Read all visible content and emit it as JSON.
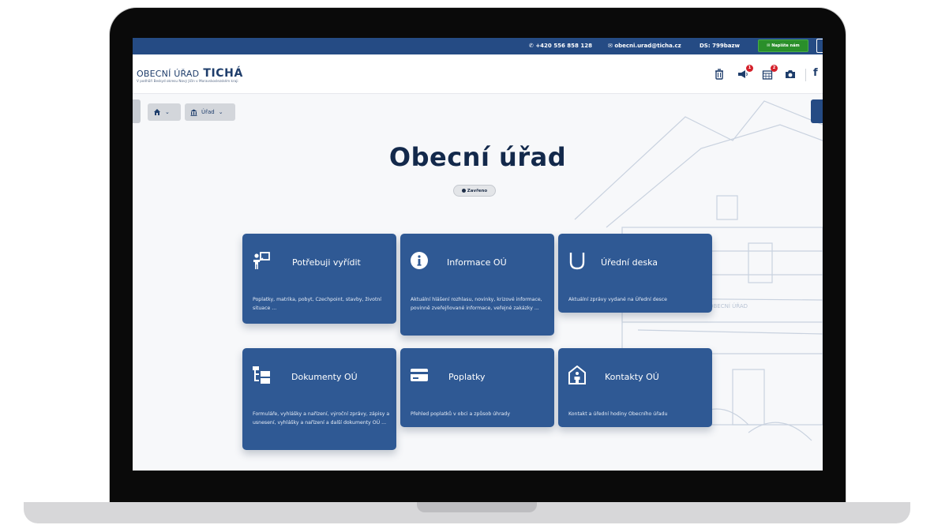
{
  "topbar": {
    "phone": "+420 556 858 128",
    "email": "obecni.urad@ticha.cz",
    "ds": "DS: 799bazw",
    "write_label": "✉ Napište nám"
  },
  "header": {
    "brand_light": "OBECNÍ ÚŘAD",
    "brand_bold": "TICHÁ",
    "brand_sub": "V podhůří Beskyd okresu Nový Jičín v Moravskoslezském kraji",
    "badges": {
      "announcements": "1",
      "calendar": "2"
    },
    "social": "f"
  },
  "breadcrumb": {
    "home_chevron": "⌄",
    "urad_label": "Úřad",
    "urad_chevron": "⌄"
  },
  "page": {
    "title": "Obecní úřad",
    "status": "Zavřeno"
  },
  "cards": [
    {
      "title": "Potřebuji vyřídit",
      "desc": "Poplatky, matrika, pobyt, Czechpoint, stavby, životní situace ...",
      "icon": "person-board-icon"
    },
    {
      "title": "Informace OÚ",
      "desc": "Aktuální hlášení rozhlasu, novinky, krizové informace, povinně zveřejňované informace, veřejné zakázky ...",
      "icon": "info-icon"
    },
    {
      "title": "Úřední deska",
      "desc": "Aktuální zprávy vydané na Úřední desce",
      "icon": "board-icon"
    },
    {
      "title": "Dokumenty OÚ",
      "desc": "Formuláře, vyhlášky a nařízení, výroční zprávy, zápisy a usnesení, vyhlášky a nařízení a další dokumenty OÚ ...",
      "icon": "documents-icon"
    },
    {
      "title": "Poplatky",
      "desc": "Přehled poplatků v obci a způsob úhrady",
      "icon": "card-icon"
    },
    {
      "title": "Kontakty OÚ",
      "desc": "Kontakt a úřední hodiny Obecního úřadu",
      "icon": "contact-icon"
    }
  ],
  "colors": {
    "primary": "#254b84",
    "card": "#2f5994",
    "title": "#13294b",
    "badge": "#d4202a",
    "write_button": "#2a8f2a"
  }
}
